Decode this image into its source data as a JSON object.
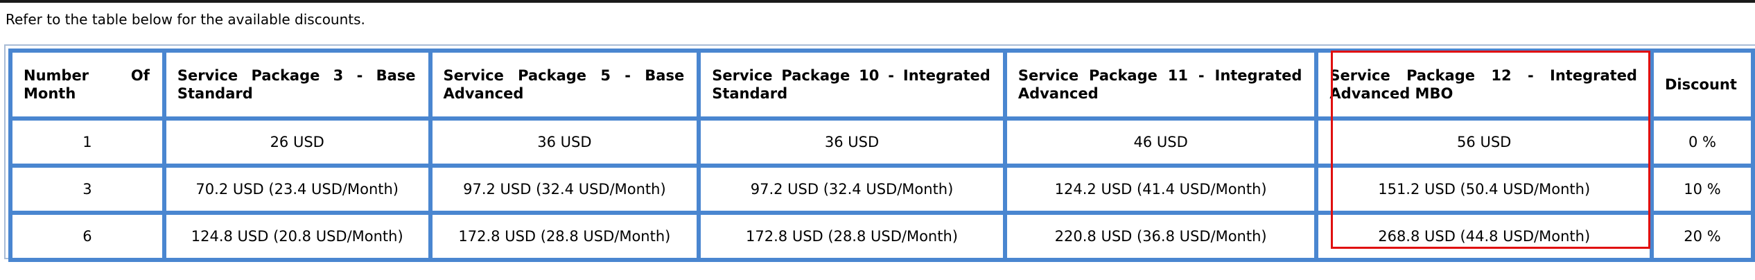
{
  "intro_text": "Refer to the table below for the available discounts.",
  "table": {
    "headers": [
      "Number Of Month",
      "Service Package 3 - Base Standard",
      "Service Package 5 - Base Advanced",
      "Service Package 10 - Integrated Standard",
      "Service Package 11 - Integrated Advanced",
      "Service Package 12 - Integrated Advanced MBO",
      "Discount"
    ],
    "rows": [
      [
        "1",
        "26 USD",
        "36 USD",
        "36 USD",
        "46 USD",
        "56 USD",
        "0 %"
      ],
      [
        "3",
        "70.2 USD (23.4 USD/Month)",
        "97.2 USD (32.4 USD/Month)",
        "97.2 USD (32.4 USD/Month)",
        "124.2 USD (41.4 USD/Month)",
        "151.2 USD (50.4 USD/Month)",
        "10 %"
      ],
      [
        "6",
        "124.8 USD (20.8 USD/Month)",
        "172.8 USD (28.8 USD/Month)",
        "172.8 USD (28.8 USD/Month)",
        "220.8 USD (36.8 USD/Month)",
        "268.8 USD (44.8 USD/Month)",
        "20 %"
      ]
    ]
  },
  "colors": {
    "table_border": "#4a86d0",
    "highlight": "#e01010"
  }
}
